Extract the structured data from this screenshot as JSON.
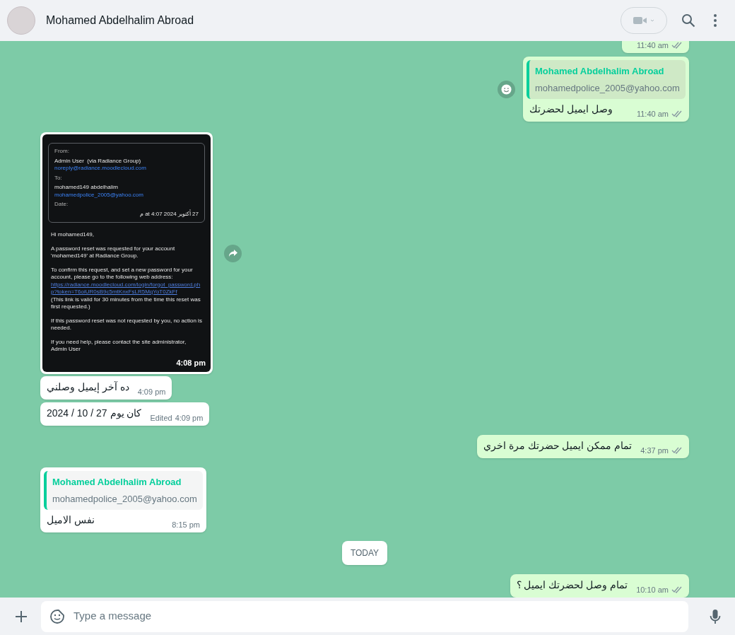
{
  "header": {
    "contact_name": "Mohamed Abdelhalim Abroad"
  },
  "messages": [
    {
      "kind": "text",
      "outgoing": true,
      "time": "11:40 am",
      "read": false
    },
    {
      "kind": "text",
      "outgoing": true,
      "quote": {
        "author": "Mohamed Abdelhalim Abroad",
        "text": "mohamedpolice_2005@yahoo.com"
      },
      "text": "وصل ايميل لحضرتك",
      "time": "11:40 am",
      "read": false,
      "react_button": true
    },
    {
      "kind": "image",
      "outgoing": false,
      "time": "4:08 pm",
      "forward_button": true,
      "email": {
        "from_label": "From:",
        "from_name": "Admin User  (via Radiance Group)",
        "from_address": "noreply@radiance.moodlecloud.com",
        "to_label": "To:",
        "to_name": "mohamed149 abdelhalim",
        "to_address": "mohamedpolice_2005@yahoo.com",
        "date_label": "Date:",
        "date": "27 أكتوبر 2024 at 4:07 م",
        "greeting": "Hi mohamed149,",
        "paragraph_1": "A password reset was requested for your account 'mohamed149' at Radiance Group.",
        "paragraph_2": "To confirm this request, and set a new password for your account, please go to the following web address:",
        "link": "https://radiance.moodlecloud.com/login/forgot_password.php?token=T6oiUR0sB9c5mtKnxFsLR5MqYoT0ZkFf",
        "paragraph_3": "(This link is valid for 30 minutes from the time this reset was first requested.)",
        "paragraph_4": "If this password reset was not requested by you, no action is needed.",
        "paragraph_5": "If you need help, please contact the site administrator,",
        "signature": "Admin User"
      }
    },
    {
      "kind": "text",
      "outgoing": false,
      "text": "ده آخر إيميل وصلني",
      "time": "4:09 pm"
    },
    {
      "kind": "text",
      "outgoing": false,
      "text": "كان يوم 27 / 10 / 2024",
      "edited": "Edited",
      "time": "4:09 pm"
    },
    {
      "kind": "text",
      "outgoing": true,
      "text": "تمام ممكن ايميل حضرتك مرة اخري",
      "time": "4:37 pm",
      "read": false
    },
    {
      "kind": "text",
      "outgoing": false,
      "quote": {
        "author": "Mohamed Abdelhalim Abroad",
        "text": "mohamedpolice_2005@yahoo.com"
      },
      "text": "نفس الاميل",
      "time": "8:15 pm"
    },
    {
      "kind": "date",
      "label": "TODAY"
    },
    {
      "kind": "text",
      "outgoing": true,
      "text": "تمام وصل لحضرتك ايميل ؟",
      "time": "10:10 am",
      "read": false
    }
  ],
  "composer": {
    "placeholder": "Type a message"
  }
}
